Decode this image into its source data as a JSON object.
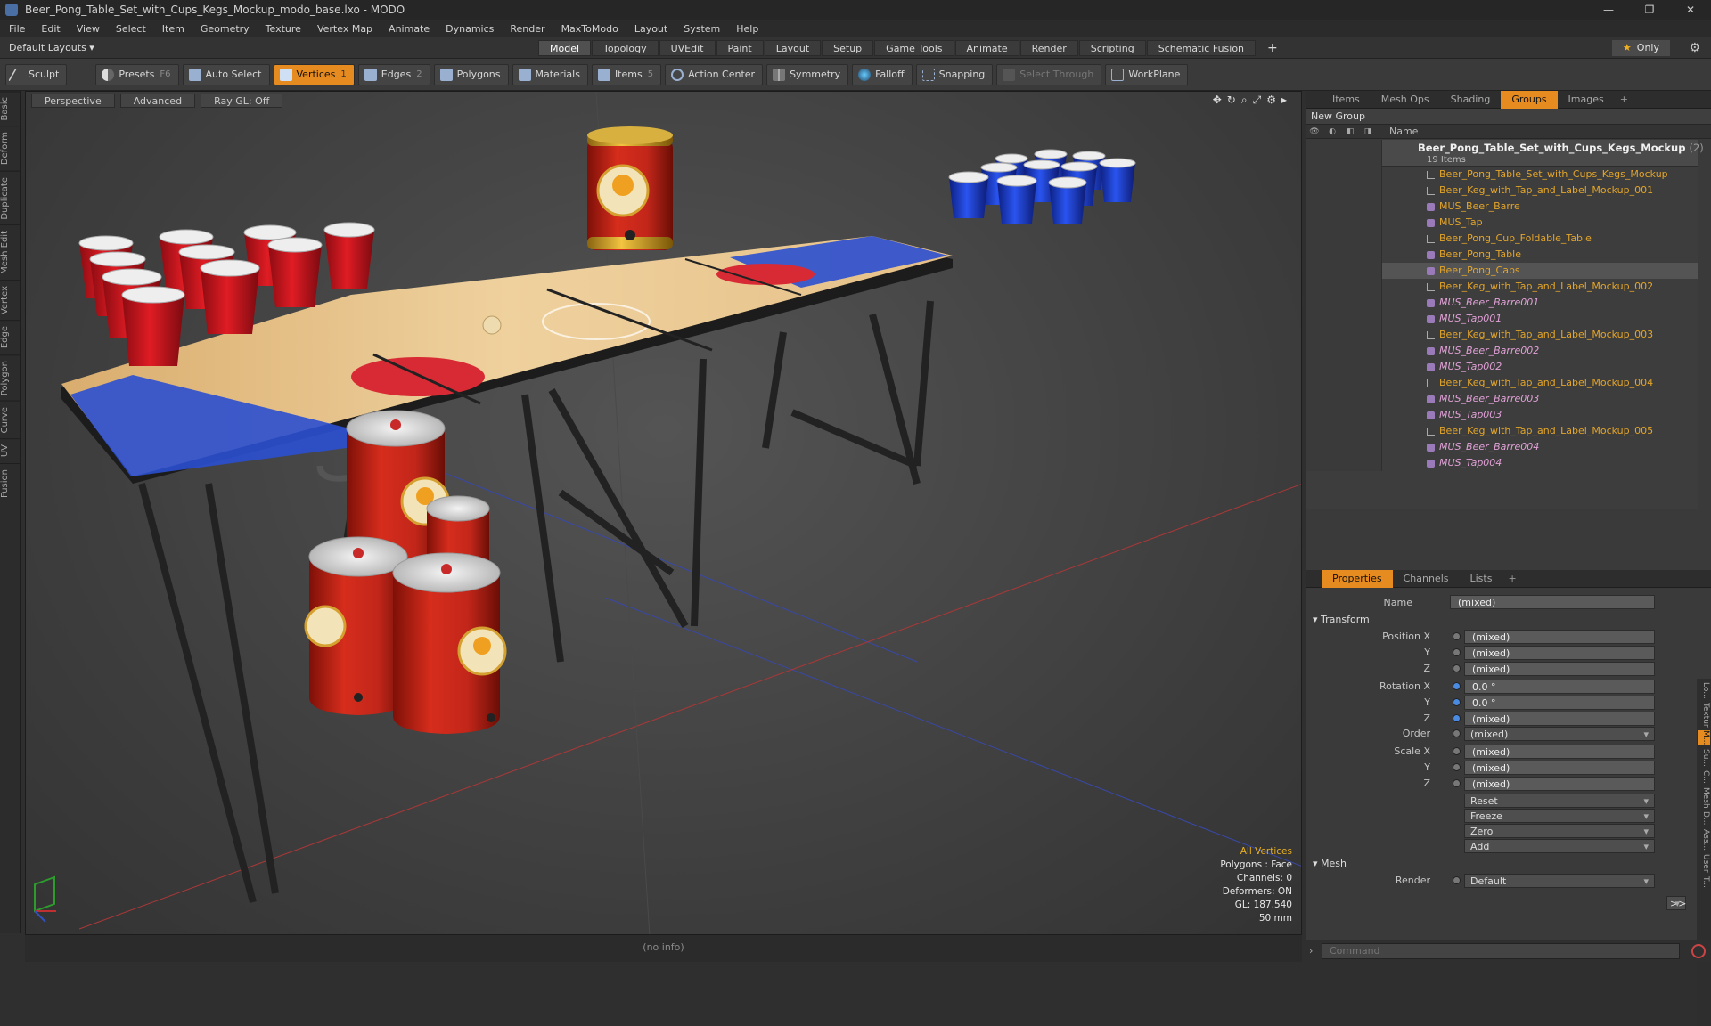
{
  "window": {
    "title": "Beer_Pong_Table_Set_with_Cups_Kegs_Mockup_modo_base.lxo - MODO",
    "controls": [
      "—",
      "❐",
      "✕"
    ]
  },
  "menu": [
    "File",
    "Edit",
    "View",
    "Select",
    "Item",
    "Geometry",
    "Texture",
    "Vertex Map",
    "Animate",
    "Dynamics",
    "Render",
    "MaxToModo",
    "Layout",
    "System",
    "Help"
  ],
  "layoutbar": {
    "default_layout": "Default Layouts ▾",
    "tabs": [
      "Model",
      "Topology",
      "UVEdit",
      "Paint",
      "Layout",
      "Setup",
      "Game Tools",
      "Animate",
      "Render",
      "Scripting",
      "Schematic Fusion"
    ],
    "active_tab": "Model",
    "plus": "+",
    "only_label": "Only"
  },
  "toolbar": {
    "sculpt": "Sculpt",
    "presets": "Presets",
    "presets_key": "F6",
    "auto_select": "Auto Select",
    "vertices": "Vertices",
    "vertices_count": "1",
    "edges": "Edges",
    "edges_count": "2",
    "polygons": "Polygons",
    "materials": "Materials",
    "items": "Items",
    "items_count": "5",
    "action_center": "Action Center",
    "symmetry": "Symmetry",
    "falloff": "Falloff",
    "snapping": "Snapping",
    "select_through": "Select Through",
    "workplane": "WorkPlane"
  },
  "left_tabs": [
    "Basic",
    "Deform",
    "Duplicate",
    "Mesh Edit",
    "Vertex",
    "Edge",
    "Polygon",
    "Curve",
    "UV",
    "Fusion"
  ],
  "viewport": {
    "perspective": "Perspective",
    "advanced": "Advanced",
    "raygl": "Ray GL: Off",
    "info": {
      "all_vertices": "All Vertices",
      "polygons": "Polygons : Face",
      "channels": "Channels: 0",
      "deformers": "Deformers: ON",
      "gl": "GL: 187,540",
      "lens": "50 mm"
    }
  },
  "status_bar": "(no info)",
  "groups_panel": {
    "tabs": [
      "Items",
      "Mesh Ops",
      "Shading",
      "Groups",
      "Images"
    ],
    "active_tab": "Groups",
    "new_group": "New Group",
    "name_col": "Name",
    "root": {
      "name": "Beer_Pong_Table_Set_with_Cups_Kegs_Mockup",
      "count": "(2)",
      "sub": "19 Items"
    },
    "items": [
      {
        "label": "Beer_Pong_Table_Set_with_Cups_Kegs_Mockup",
        "kind": "group"
      },
      {
        "label": "Beer_Keg_with_Tap_and_Label_Mockup_001",
        "kind": "group"
      },
      {
        "label": "MUS_Beer_Barre",
        "kind": "mesh"
      },
      {
        "label": "MUS_Tap",
        "kind": "mesh"
      },
      {
        "label": "Beer_Pong_Cup_Foldable_Table",
        "kind": "group"
      },
      {
        "label": "Beer_Pong_Table",
        "kind": "mesh"
      },
      {
        "label": "Beer_Pong_Caps",
        "kind": "mesh"
      },
      {
        "label": "Beer_Keg_with_Tap_and_Label_Mockup_002",
        "kind": "group"
      },
      {
        "label": "MUS_Beer_Barre001",
        "kind": "instance"
      },
      {
        "label": "MUS_Tap001",
        "kind": "instance"
      },
      {
        "label": "Beer_Keg_with_Tap_and_Label_Mockup_003",
        "kind": "group"
      },
      {
        "label": "MUS_Beer_Barre002",
        "kind": "instance"
      },
      {
        "label": "MUS_Tap002",
        "kind": "instance"
      },
      {
        "label": "Beer_Keg_with_Tap_and_Label_Mockup_004",
        "kind": "group"
      },
      {
        "label": "MUS_Beer_Barre003",
        "kind": "instance"
      },
      {
        "label": "MUS_Tap003",
        "kind": "instance"
      },
      {
        "label": "Beer_Keg_with_Tap_and_Label_Mockup_005",
        "kind": "group"
      },
      {
        "label": "MUS_Beer_Barre004",
        "kind": "instance"
      },
      {
        "label": "MUS_Tap004",
        "kind": "instance"
      }
    ]
  },
  "properties_panel": {
    "tabs": [
      "Properties",
      "Channels",
      "Lists"
    ],
    "active_tab": "Properties",
    "name_label": "Name",
    "name_value": "(mixed)",
    "transform": "Transform",
    "position_label": "Position X",
    "rotation_label": "Rotation X",
    "order_label": "Order",
    "scale_label": "Scale X",
    "y": "Y",
    "z": "Z",
    "position": [
      "(mixed)",
      "(mixed)",
      "(mixed)"
    ],
    "rotation": [
      "0.0 °",
      "0.0 °",
      "(mixed)"
    ],
    "order": "(mixed)",
    "scale": [
      "(mixed)",
      "(mixed)",
      "(mixed)"
    ],
    "buttons": [
      "Reset",
      "Freeze",
      "Zero",
      "Add"
    ],
    "mesh": "Mesh",
    "render_label": "Render",
    "render_value": "Default",
    "more": ">>"
  },
  "right_vtabs": [
    "Lo...",
    "Textur",
    "M...",
    "Su...",
    "C...",
    "Mesh",
    "D...",
    "Ass...",
    "User",
    "T..."
  ],
  "command": {
    "placeholder": "Command"
  },
  "colors": {
    "accent": "#e68b1f",
    "cup_red": "#d4141e",
    "cup_blue": "#1a3ed8",
    "keg_red": "#c8281a",
    "table_wood": "#e8c48a"
  }
}
